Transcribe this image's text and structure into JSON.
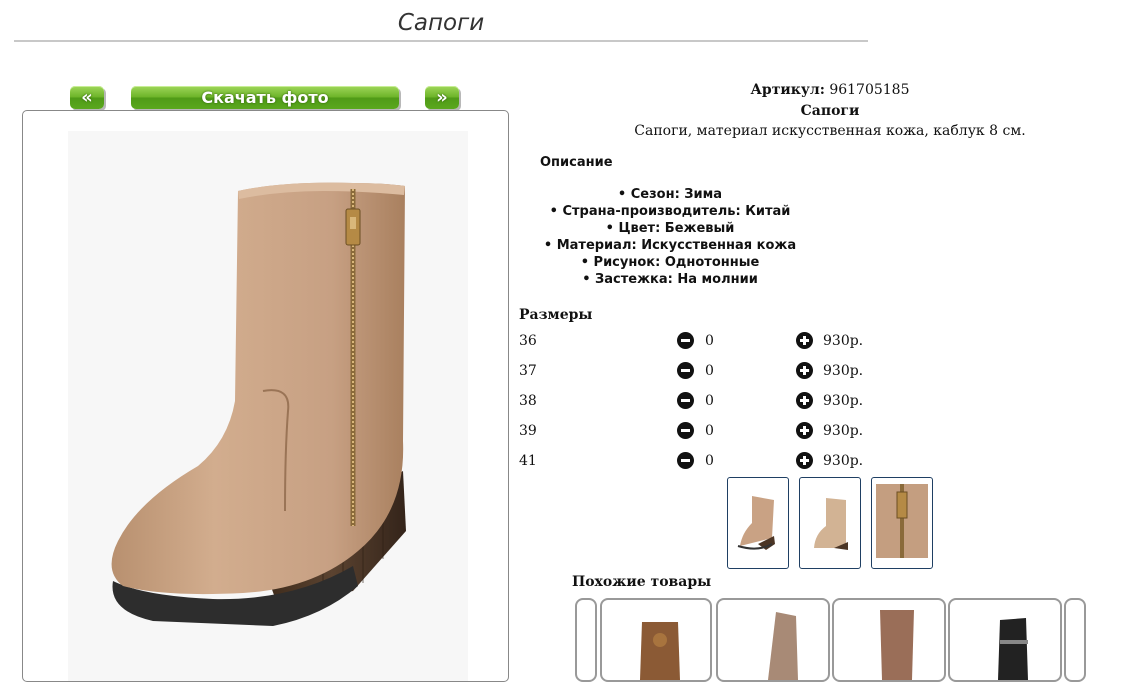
{
  "page": {
    "title": "Сапоги"
  },
  "gallery": {
    "prev_label": "«",
    "download_label": "Скачать фото",
    "next_label": "»"
  },
  "product": {
    "article_label": "Артикул:",
    "article_value": "961705185",
    "name": "Сапоги",
    "short_description": "Сапоги, материал искусственная кожа, каблук 8 см."
  },
  "description": {
    "heading": "Описание",
    "items": [
      "• Сезон: Зима",
      "• Страна-производитель: Китай",
      "• Цвет: Бежевый",
      "• Материал: Искусственная кожа",
      "• Рисунок: Однотонные",
      "• Застежка: На молнии"
    ]
  },
  "sizes": {
    "heading": "Размеры",
    "rows": [
      {
        "size": "36",
        "qty": "0",
        "price": "930р."
      },
      {
        "size": "37",
        "qty": "0",
        "price": "930р."
      },
      {
        "size": "38",
        "qty": "0",
        "price": "930р."
      },
      {
        "size": "39",
        "qty": "0",
        "price": "930р."
      },
      {
        "size": "41",
        "qty": "0",
        "price": "930р."
      }
    ]
  },
  "thumbnails": [
    "boot-side-view",
    "boot-front-view",
    "zipper-closeup"
  ],
  "similar": {
    "heading": "Похожие товары",
    "items": [
      "brown-knit-boot",
      "taupe-slouch-boot",
      "brown-tall-boot",
      "black-buckle-boot"
    ]
  },
  "colors": {
    "boot_beige": "#c9a284",
    "wedge_brown": "#4b3525",
    "button_green": "#5aa81e",
    "thumb_border": "#1f3f63"
  }
}
